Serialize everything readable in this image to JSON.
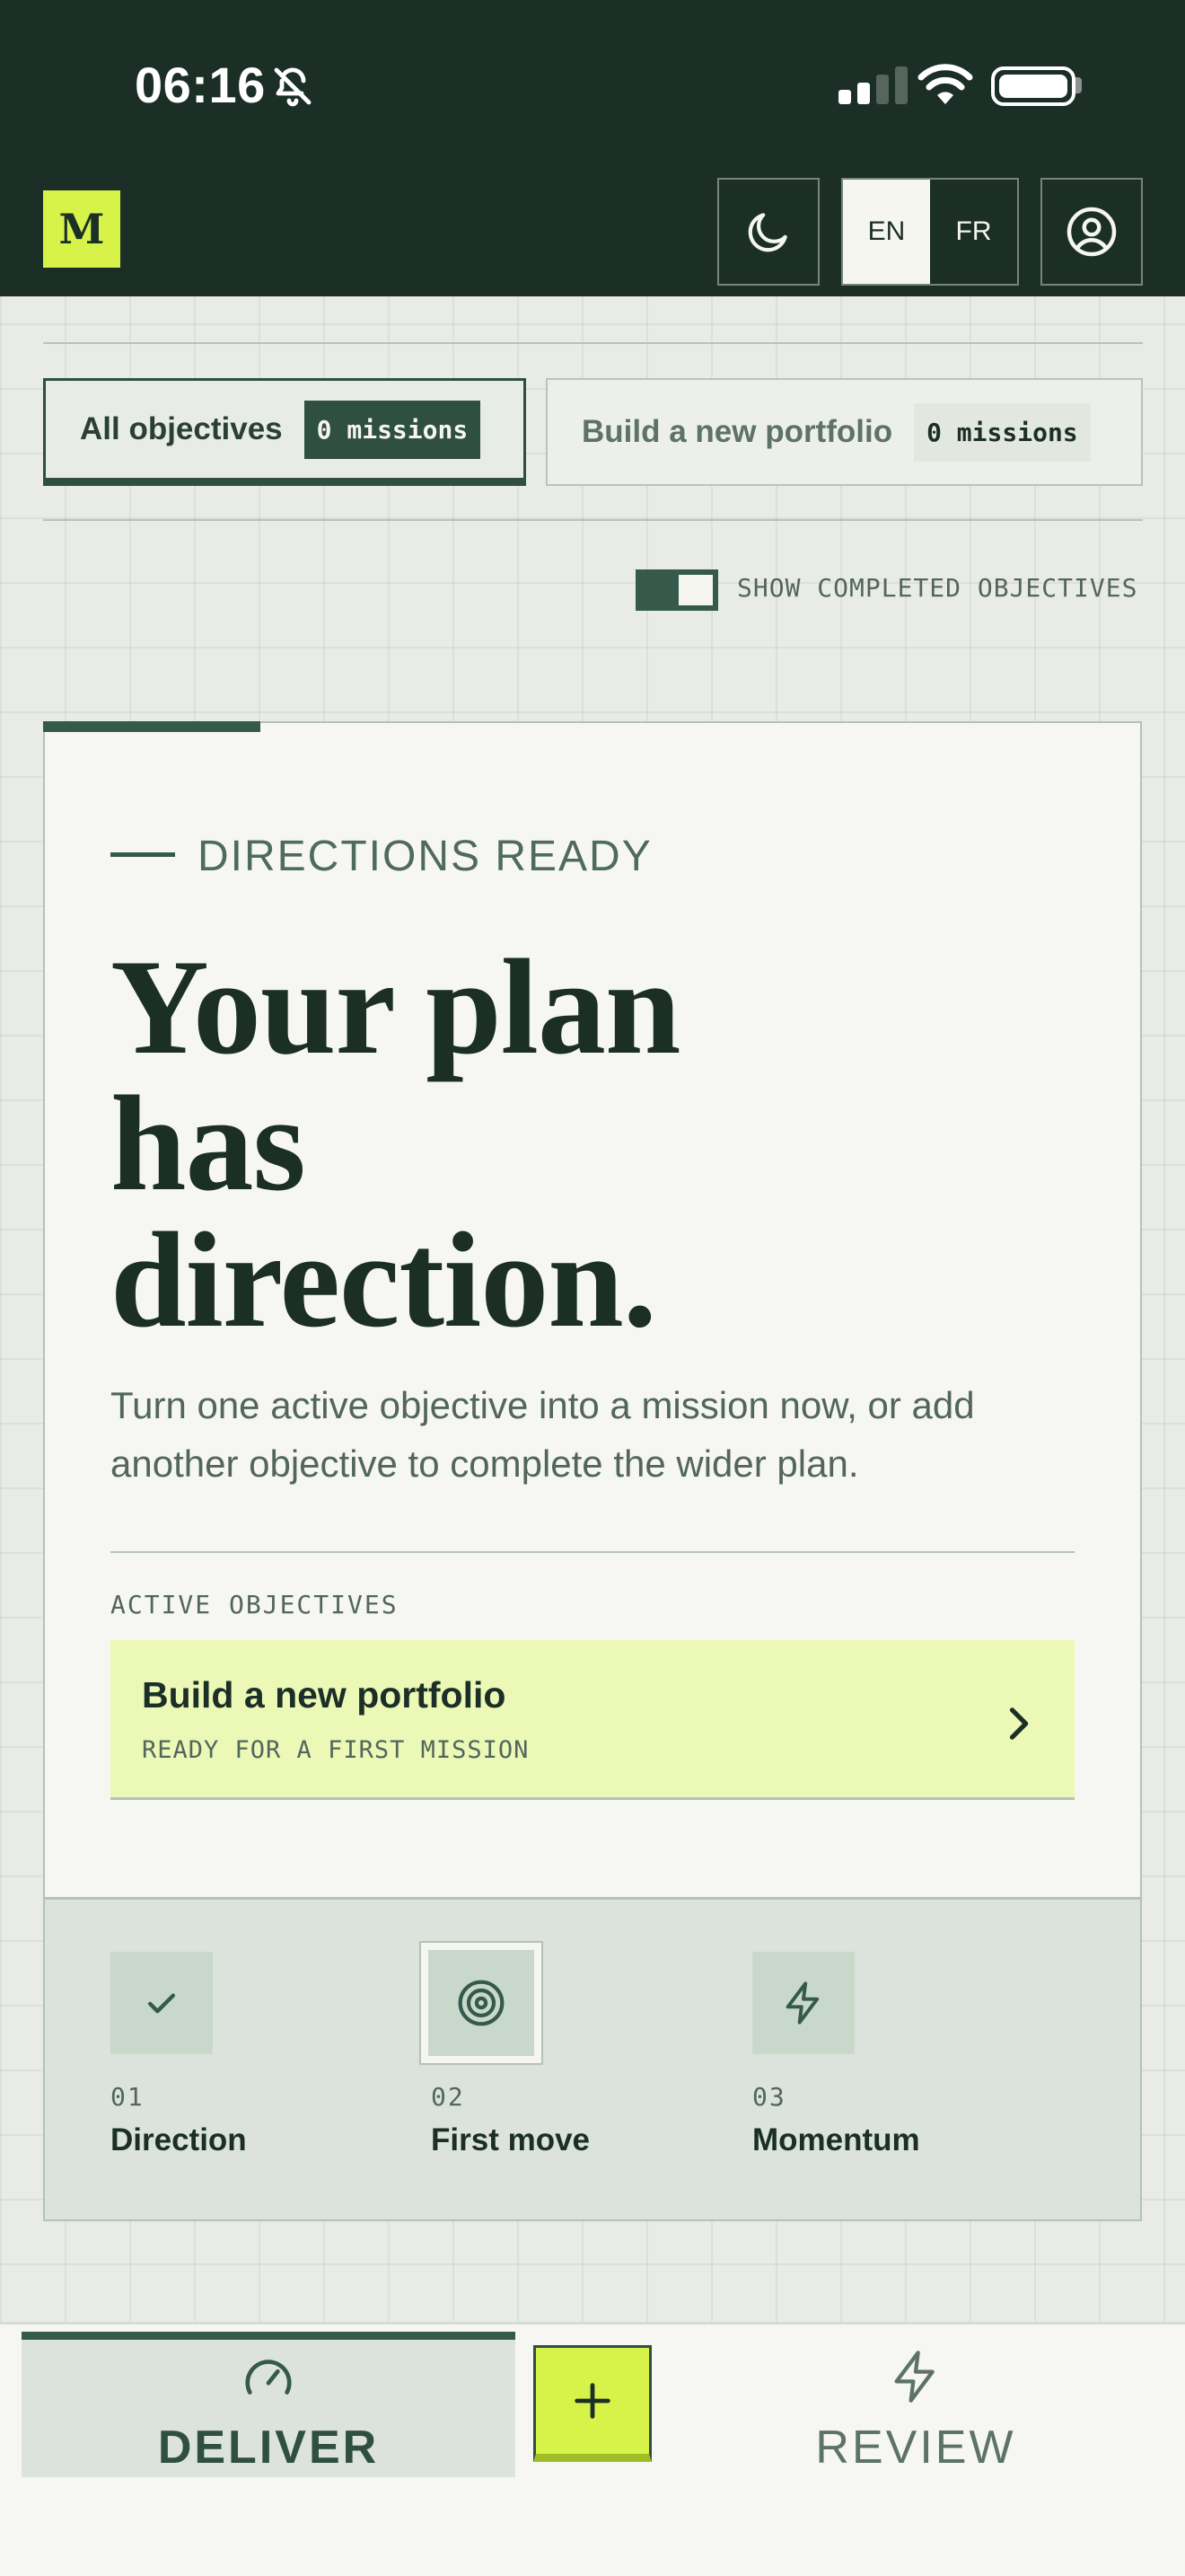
{
  "status_bar": {
    "time": "06:16",
    "icons": [
      "bell-slash-icon",
      "cellular-signal-icon",
      "wifi-icon",
      "battery-icon"
    ]
  },
  "header": {
    "logo_text": "M",
    "language": {
      "options": [
        "EN",
        "FR"
      ],
      "selected": "EN"
    },
    "icons": [
      "moon-icon",
      "user-icon"
    ]
  },
  "filters": {
    "chips": [
      {
        "label": "All objectives",
        "count": "0 missions",
        "active": true
      },
      {
        "label": "Build a new portfolio",
        "count": "0 missions",
        "active": false
      }
    ],
    "show_completed": {
      "label": "SHOW COMPLETED OBJECTIVES",
      "on": true
    }
  },
  "hero": {
    "eyebrow": "DIRECTIONS READY",
    "headline": "Your plan has direction.",
    "description": "Turn one active objective into a mission now, or add another objective to complete the wider plan.",
    "section_label": "ACTIVE OBJECTIVES",
    "objective": {
      "title": "Build a new portfolio",
      "status": "READY FOR A FIRST MISSION"
    }
  },
  "steps": [
    {
      "number": "01",
      "name": "Direction",
      "icon": "check-icon",
      "state": "done"
    },
    {
      "number": "02",
      "name": "First move",
      "icon": "target-icon",
      "state": "current"
    },
    {
      "number": "03",
      "name": "Momentum",
      "icon": "lightning-icon",
      "state": "upcoming"
    }
  ],
  "bottom_nav": {
    "items": [
      {
        "label": "DELIVER",
        "icon": "gauge-icon",
        "active": true
      },
      {
        "label": "REVIEW",
        "icon": "lightning-icon",
        "active": false
      }
    ],
    "add_icon": "plus-icon"
  },
  "colors": {
    "header_bg": "#1b2f27",
    "accent_lime": "#d7f34a",
    "primary_green": "#35594a",
    "card_bg": "#f6f7f2",
    "objective_highlight": "#ebf8b6",
    "page_bg": "#e9ece6"
  }
}
